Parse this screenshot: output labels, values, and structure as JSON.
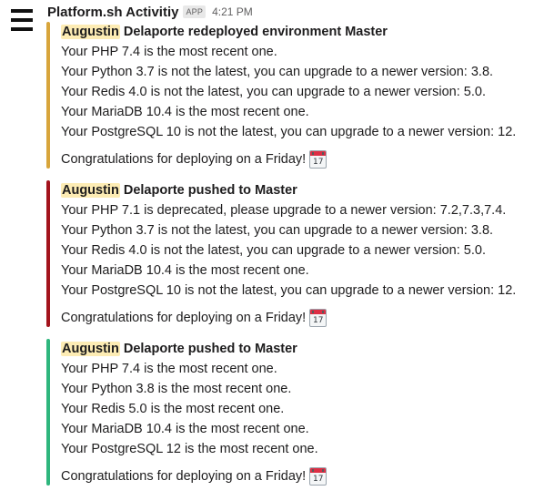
{
  "message": {
    "app_name": "Platform.sh Activitiy",
    "badge": "APP",
    "time": "4:21 PM",
    "avatar_icon": "hamburger-menu-icon"
  },
  "attachments": [
    {
      "color": "#d8a53b",
      "mention": "Augustin",
      "title_rest": " Delaporte redeployed environment Master",
      "lines": [
        "Your PHP 7.4 is the most recent one.",
        "Your Python 3.7 is not the latest, you can upgrade to a newer version: 3.8.",
        "Your Redis 4.0 is not the latest, you can upgrade to a newer version: 5.0.",
        "Your MariaDB 10.4 is the most recent one.",
        "Your PostgreSQL 10 is not the latest, you can upgrade to a newer version: 12."
      ],
      "congrats": "Congratulations for deploying on a Friday!",
      "emoji": "calendar-icon",
      "calendar_day": "17"
    },
    {
      "color": "#a3131c",
      "mention": "Augustin",
      "title_rest": " Delaporte pushed to Master",
      "lines": [
        "Your PHP 7.1 is deprecated, please upgrade to a newer version: 7.2,7.3,7.4.",
        "Your Python 3.7 is not the latest, you can upgrade to a newer version: 3.8.",
        "Your Redis 4.0 is not the latest, you can upgrade to a newer version: 5.0.",
        "Your MariaDB 10.4 is the most recent one.",
        "Your PostgreSQL 10 is not the latest, you can upgrade to a newer version: 12."
      ],
      "congrats": "Congratulations for deploying on a Friday!",
      "emoji": "calendar-icon",
      "calendar_day": "17"
    },
    {
      "color": "#2eb67d",
      "mention": "Augustin",
      "title_rest": " Delaporte pushed to Master",
      "lines": [
        "Your PHP 7.4 is the most recent one.",
        "Your Python 3.8 is the most recent one.",
        "Your Redis 5.0 is the most recent one.",
        "Your MariaDB 10.4 is the most recent one.",
        "Your PostgreSQL 12 is the most recent one."
      ],
      "congrats": "Congratulations for deploying on a Friday!",
      "emoji": "calendar-icon",
      "calendar_day": "17"
    }
  ]
}
